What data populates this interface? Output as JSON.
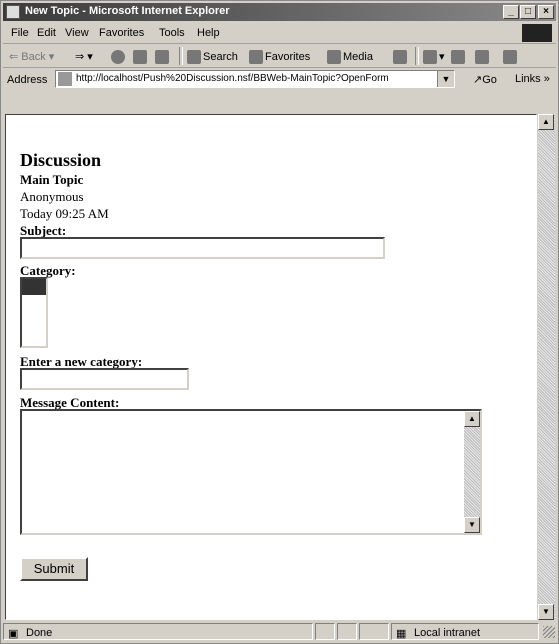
{
  "window": {
    "title": "New Topic - Microsoft Internet Explorer"
  },
  "menu": [
    "File",
    "Edit",
    "View",
    "Favorites",
    "Tools",
    "Help"
  ],
  "toolbar": {
    "back": "Back",
    "search": "Search",
    "favorites": "Favorites",
    "media": "Media"
  },
  "address": {
    "label": "Address",
    "url": "http://localhost/Push%20Discussion.nsf/BBWeb-MainTopic?OpenForm",
    "go": "Go",
    "links": "Links"
  },
  "page": {
    "heading": "Discussion",
    "form_type": "Main Topic",
    "author": "Anonymous",
    "timestamp": "Today 09:25 AM",
    "subject_label": "Subject:",
    "category_label": "Category:",
    "new_category_label": "Enter a new category:",
    "message_label": "Message Content:",
    "submit_label": "Submit"
  },
  "status": {
    "text": "Done",
    "zone": "Local intranet"
  }
}
